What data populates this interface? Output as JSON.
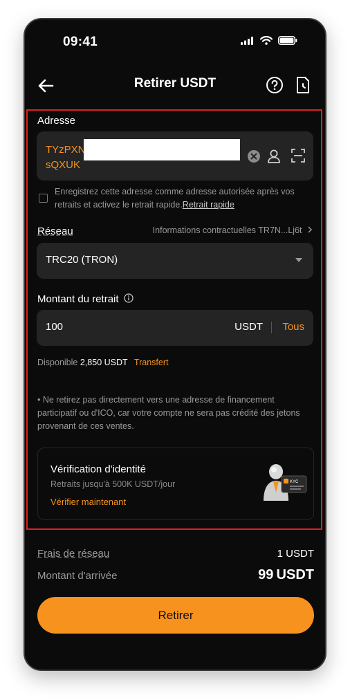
{
  "status": {
    "time": "09:41"
  },
  "header": {
    "title": "Retirer USDT"
  },
  "address": {
    "label": "Adresse",
    "line1": "TYzPXN",
    "line2": "sQXUK"
  },
  "save_address": {
    "text": "Enregistrez cette adresse comme adresse autorisée après vos retraits et activez le retrait rapide.",
    "link": "Retrait rapide"
  },
  "network": {
    "label": "Réseau",
    "info": "Informations contractuelles TR7N...Lj6t",
    "value": "TRC20 (TRON)"
  },
  "amount": {
    "label": "Montant du retrait",
    "value": "100",
    "unit": "USDT",
    "all_label": "Tous"
  },
  "available": {
    "label": "Disponible",
    "balance": "2,850 USDT",
    "transfer": "Transfert"
  },
  "note": "Ne retirez pas directement vers une adresse de financement participatif ou d'ICO, car votre compte ne sera pas crédité des jetons provenant de ces ventes.",
  "kyc": {
    "title": "Vérification d'identité",
    "subtitle": "Retraits jusqu'à 500K USDT/jour",
    "link": "Vérifier maintenant",
    "badge": "KYC"
  },
  "fees": {
    "network_label": "Frais de réseau",
    "network_value": "1 USDT",
    "arrival_label": "Montant d'arrivée",
    "arrival_value": "99",
    "arrival_unit": "USDT"
  },
  "submit_label": "Retirer",
  "colors": {
    "accent": "#f7921e",
    "background": "#0b0b0b",
    "field": "#242424",
    "highlight": "#e31e1e"
  },
  "icons": [
    "back-arrow-icon",
    "help-icon",
    "history-icon",
    "clear-icon",
    "address-book-icon",
    "scan-icon",
    "info-icon",
    "chevron-right-icon",
    "dropdown-caret-icon",
    "kyc-illustration-icon"
  ]
}
